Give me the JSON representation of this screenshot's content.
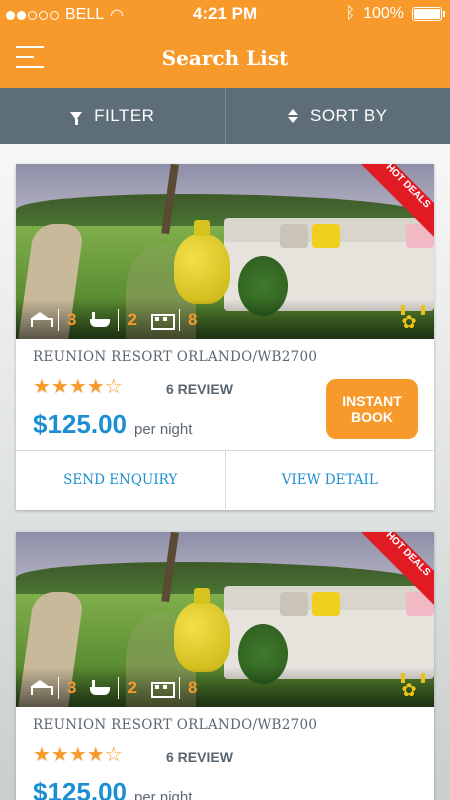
{
  "status_bar": {
    "carrier": "BELL",
    "time": "4:21 PM",
    "battery": "100%"
  },
  "header": {
    "title": "Search List"
  },
  "toolbar": {
    "filter_label": "FILTER",
    "sort_label": "SORT BY"
  },
  "colors": {
    "accent": "#f89a2b",
    "toolbar": "#5d6e79",
    "price": "#1b8fd1",
    "hot_badge": "#e01b24"
  },
  "listings": [
    {
      "badge": "HOT DEALS",
      "bedrooms": "3",
      "bathrooms": "2",
      "sleeps": "8",
      "name": "REUNION RESORT ORLANDO/WB2700",
      "rating": 4,
      "stars": "★★★★☆",
      "reviews": "6 REVIEW",
      "price": "$125.00",
      "price_unit": "per night",
      "instant_book_label": "INSTANT BOOK",
      "send_enquiry_label": "SEND ENQUIRY",
      "view_detail_label": "VIEW DETAIL"
    },
    {
      "badge": "HOT DEALS",
      "bedrooms": "3",
      "bathrooms": "2",
      "sleeps": "8",
      "name": "REUNION RESORT ORLANDO/WB2700",
      "rating": 4,
      "stars": "★★★★☆",
      "reviews": "6 REVIEW",
      "price": "$125.00",
      "price_unit": "per night"
    }
  ]
}
